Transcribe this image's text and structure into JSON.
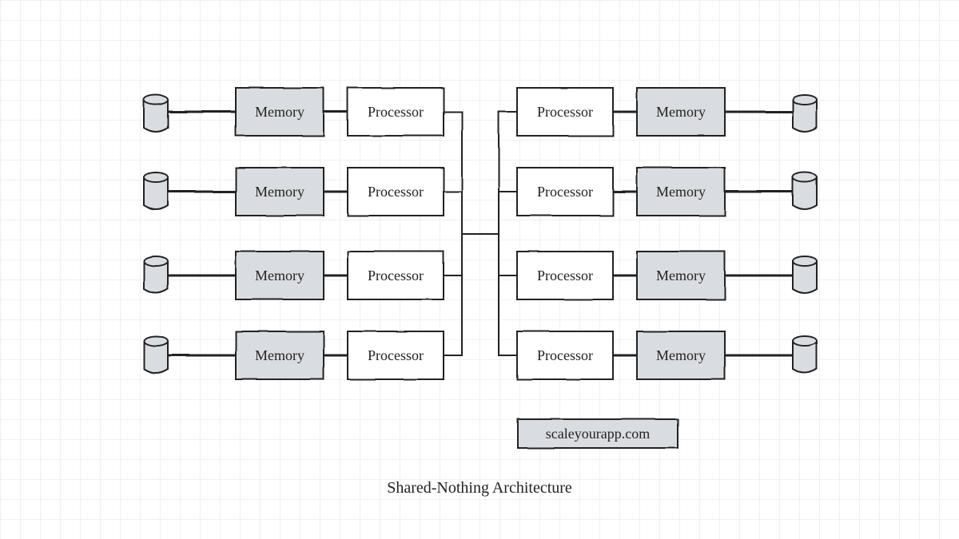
{
  "title": "Shared-Nothing Architecture",
  "watermark": "scaleyourapp.com",
  "labels": {
    "memory": "Memory",
    "processor": "Processor"
  },
  "colors": {
    "fill_shaded": "#d9dde2",
    "fill_plain": "#ffffff",
    "stroke": "#222222"
  },
  "left_nodes": [
    {
      "storage": true,
      "memory": "Memory",
      "processor": "Processor"
    },
    {
      "storage": true,
      "memory": "Memory",
      "processor": "Processor"
    },
    {
      "storage": true,
      "memory": "Memory",
      "processor": "Processor"
    },
    {
      "storage": true,
      "memory": "Memory",
      "processor": "Processor"
    }
  ],
  "right_nodes": [
    {
      "storage": true,
      "memory": "Memory",
      "processor": "Processor"
    },
    {
      "storage": true,
      "memory": "Memory",
      "processor": "Processor"
    },
    {
      "storage": true,
      "memory": "Memory",
      "processor": "Processor"
    },
    {
      "storage": true,
      "memory": "Memory",
      "processor": "Processor"
    }
  ]
}
